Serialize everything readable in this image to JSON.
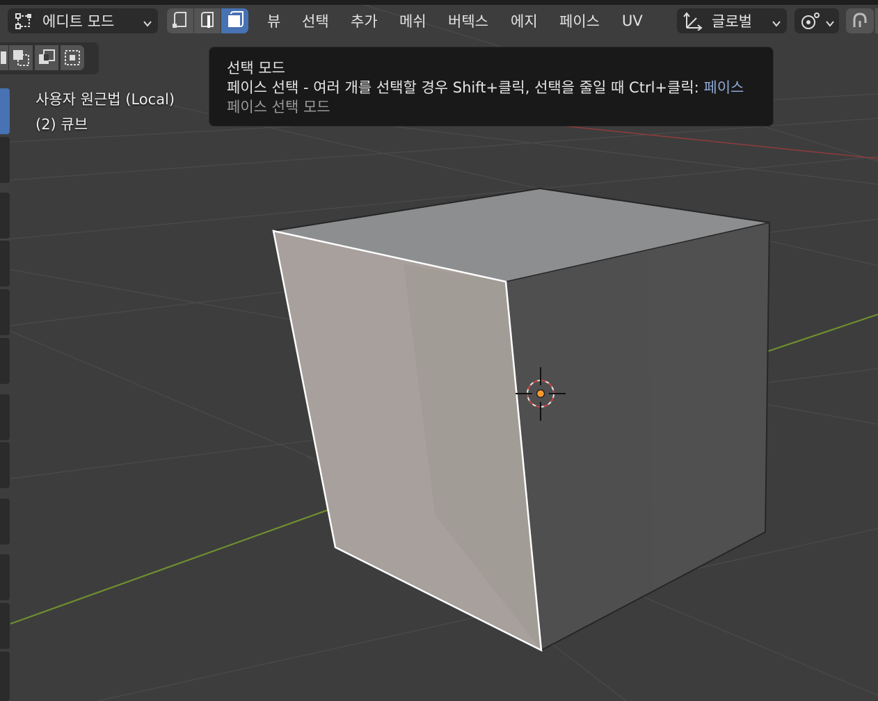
{
  "header": {
    "mode_dropdown": {
      "label": "에디트 모드",
      "icon": "edit-mode-icon"
    },
    "select_modes": [
      {
        "name": "vertex-select",
        "icon": "vertex-select-icon",
        "active": false
      },
      {
        "name": "edge-select",
        "icon": "edge-select-icon",
        "active": false
      },
      {
        "name": "face-select",
        "icon": "face-select-icon",
        "active": true
      }
    ],
    "menus": [
      "뷰",
      "선택",
      "추가",
      "메쉬",
      "버텍스",
      "에지",
      "페이스",
      "UV"
    ],
    "orientation_dropdown": {
      "label": "글로벌",
      "icon": "transform-orientation-icon"
    },
    "pivot_dropdown": {
      "icon": "pivot-point-icon"
    },
    "snap_button": {
      "icon": "magnet-icon"
    }
  },
  "box_select_modes": [
    "new-selection-icon",
    "extend-selection-icon",
    "subtract-selection-icon",
    "invert-selection-icon"
  ],
  "viewport_overlay": {
    "view_name": "사용자 원근법 (Local)",
    "object_info": "(2) 큐브"
  },
  "tooltip": {
    "title": "선택 모드",
    "description": "페이스 선택 - 여러 개를 선택할 경우 Shift+클릭, 선택을 줄일 때 Ctrl+클릭:",
    "keyword": "페이스",
    "subtitle": "페이스 선택 모드"
  },
  "colors": {
    "accent": "#4772b3",
    "viewport_bg": "#3d3d3d",
    "x_axis": "#b24848",
    "y_axis": "#6f8f2e",
    "selected_face": "#a8a09c",
    "origin_dot": "#ff9a2e"
  }
}
